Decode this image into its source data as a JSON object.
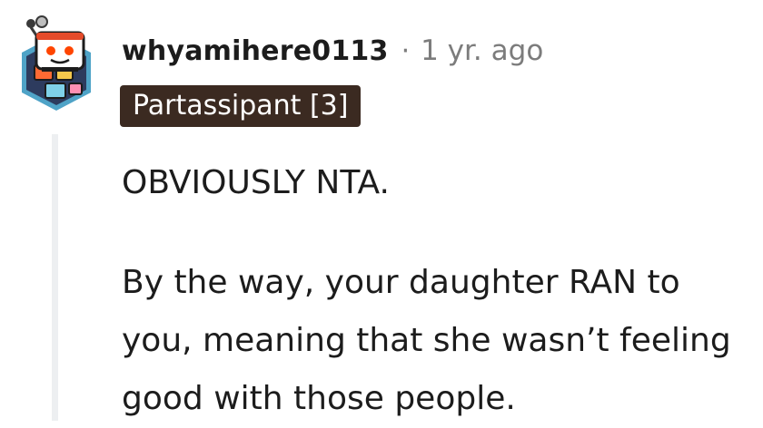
{
  "comment": {
    "username": "whyamihere0113",
    "separator": "·",
    "timestamp": "1 yr. ago",
    "flair": "Partassipant [3]",
    "paragraphs": [
      "OBVIOUSLY NTA.",
      "By the way, your daughter RAN to you, meaning that she wasn’t feeling good with those people."
    ]
  },
  "avatar": {
    "icon": "snoo-avatar-icon",
    "colors": {
      "hex_outer": "#4fa3c7",
      "hex_inner": "#29365a",
      "accent_orange": "#ff6a33",
      "accent_yellow": "#f5c84c",
      "snoo_white": "#ffffff"
    }
  },
  "colors": {
    "text": "#1c1c1c",
    "meta": "#7c7c7c",
    "flair_bg": "#3b2a21",
    "flair_text": "#ffffff",
    "thread_line": "#edeff1"
  }
}
